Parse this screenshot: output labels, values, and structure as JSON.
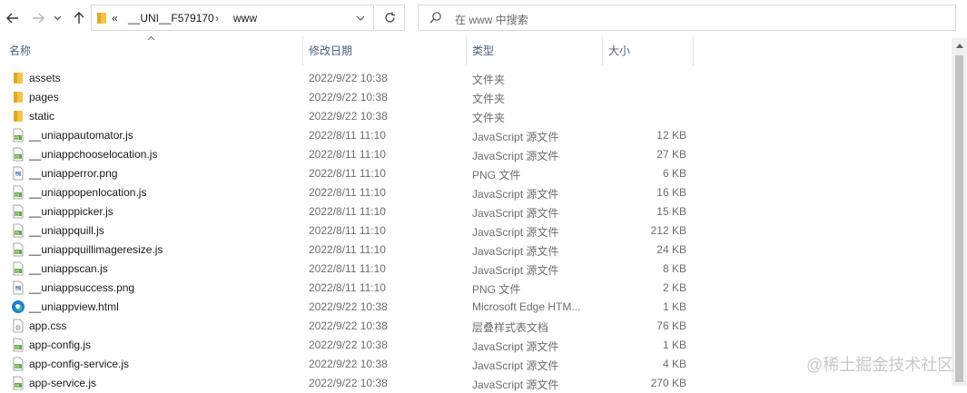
{
  "address": {
    "prefix": "«",
    "path": [
      "__UNI__F579170",
      "www"
    ],
    "separator": "›"
  },
  "search": {
    "placeholder": "在 www 中搜索"
  },
  "columns": {
    "name": "名称",
    "date": "修改日期",
    "type": "类型",
    "size": "大小"
  },
  "files": [
    {
      "name": "assets",
      "date": "2022/9/22 10:38",
      "type": "文件夹",
      "size": "",
      "icon": "folder-icon"
    },
    {
      "name": "pages",
      "date": "2022/9/22 10:38",
      "type": "文件夹",
      "size": "",
      "icon": "folder-icon"
    },
    {
      "name": "static",
      "date": "2022/9/22 10:38",
      "type": "文件夹",
      "size": "",
      "icon": "folder-icon"
    },
    {
      "name": "__uniappautomator.js",
      "date": "2022/8/11 11:10",
      "type": "JavaScript 源文件",
      "size": "12 KB",
      "icon": "js-file-icon"
    },
    {
      "name": "__uniappchooselocation.js",
      "date": "2022/8/11 11:10",
      "type": "JavaScript 源文件",
      "size": "27 KB",
      "icon": "js-file-icon"
    },
    {
      "name": "__uniapperror.png",
      "date": "2022/8/11 11:10",
      "type": "PNG 文件",
      "size": "6 KB",
      "icon": "png-file-icon"
    },
    {
      "name": "__uniappopenlocation.js",
      "date": "2022/8/11 11:10",
      "type": "JavaScript 源文件",
      "size": "16 KB",
      "icon": "js-file-icon"
    },
    {
      "name": "__uniapppicker.js",
      "date": "2022/8/11 11:10",
      "type": "JavaScript 源文件",
      "size": "15 KB",
      "icon": "js-file-icon"
    },
    {
      "name": "__uniappquill.js",
      "date": "2022/8/11 11:10",
      "type": "JavaScript 源文件",
      "size": "212 KB",
      "icon": "js-file-icon"
    },
    {
      "name": "__uniappquillimageresize.js",
      "date": "2022/8/11 11:10",
      "type": "JavaScript 源文件",
      "size": "24 KB",
      "icon": "js-file-icon"
    },
    {
      "name": "__uniappscan.js",
      "date": "2022/8/11 11:10",
      "type": "JavaScript 源文件",
      "size": "8 KB",
      "icon": "js-file-icon"
    },
    {
      "name": "__uniappsuccess.png",
      "date": "2022/8/11 11:10",
      "type": "PNG 文件",
      "size": "2 KB",
      "icon": "png-file-icon"
    },
    {
      "name": "__uniappview.html",
      "date": "2022/9/22 10:38",
      "type": "Microsoft Edge HTM...",
      "size": "1 KB",
      "icon": "edge-html-icon"
    },
    {
      "name": "app.css",
      "date": "2022/9/22 10:38",
      "type": "层叠样式表文档",
      "size": "76 KB",
      "icon": "css-file-icon"
    },
    {
      "name": "app-config.js",
      "date": "2022/9/22 10:38",
      "type": "JavaScript 源文件",
      "size": "1 KB",
      "icon": "js-file-icon"
    },
    {
      "name": "app-config-service.js",
      "date": "2022/9/22 10:38",
      "type": "JavaScript 源文件",
      "size": "4 KB",
      "icon": "js-file-icon"
    },
    {
      "name": "app-service.js",
      "date": "2022/9/22 10:38",
      "type": "JavaScript 源文件",
      "size": "270 KB",
      "icon": "js-file-icon"
    }
  ],
  "watermark": "@稀土掘金技术社区",
  "colors": {
    "folder": "#f6c343",
    "js_badge": "#6aa84f",
    "edge": "#1a7fd4",
    "header_text": "#4c607a"
  }
}
